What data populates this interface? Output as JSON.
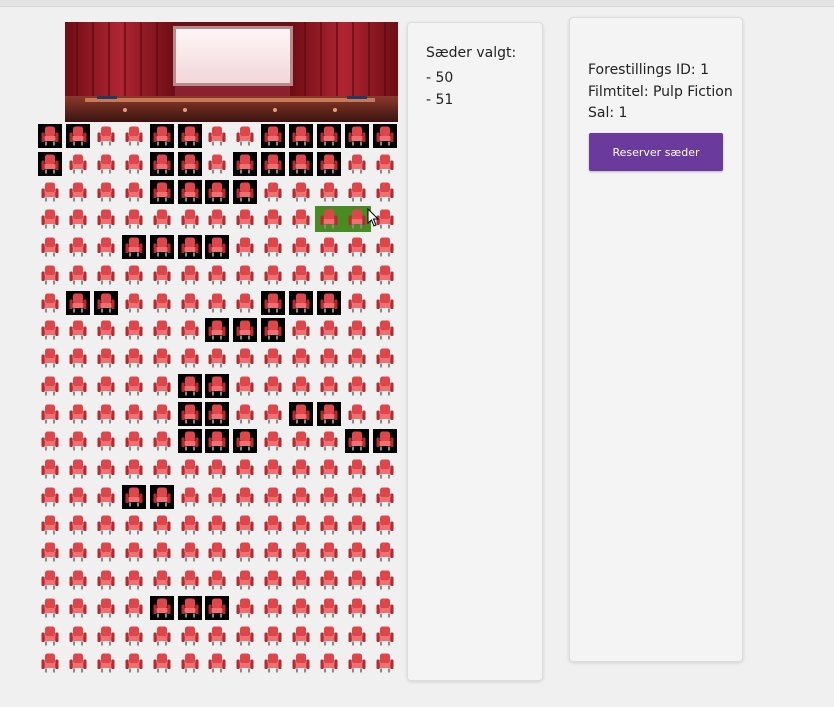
{
  "colors": {
    "accent": "#6a3a9c",
    "seat_red": "#e0454a",
    "reserved_bg": "#000000",
    "selected_bg": "#4a8a22"
  },
  "seating": {
    "rows": 20,
    "cols": 13,
    "reserved": [
      [
        0,
        0
      ],
      [
        0,
        1
      ],
      [
        0,
        4
      ],
      [
        0,
        5
      ],
      [
        0,
        8
      ],
      [
        0,
        9
      ],
      [
        0,
        10
      ],
      [
        0,
        11
      ],
      [
        0,
        12
      ],
      [
        1,
        0
      ],
      [
        1,
        4
      ],
      [
        1,
        5
      ],
      [
        1,
        7
      ],
      [
        1,
        8
      ],
      [
        1,
        9
      ],
      [
        1,
        10
      ],
      [
        2,
        4
      ],
      [
        2,
        5
      ],
      [
        2,
        6
      ],
      [
        2,
        7
      ],
      [
        4,
        3
      ],
      [
        4,
        4
      ],
      [
        4,
        5
      ],
      [
        4,
        6
      ],
      [
        6,
        1
      ],
      [
        6,
        2
      ],
      [
        6,
        8
      ],
      [
        6,
        9
      ],
      [
        6,
        10
      ],
      [
        7,
        6
      ],
      [
        7,
        7
      ],
      [
        7,
        8
      ],
      [
        9,
        5
      ],
      [
        9,
        6
      ],
      [
        10,
        5
      ],
      [
        10,
        6
      ],
      [
        10,
        9
      ],
      [
        10,
        10
      ],
      [
        11,
        5
      ],
      [
        11,
        6
      ],
      [
        11,
        7
      ],
      [
        11,
        11
      ],
      [
        11,
        12
      ],
      [
        13,
        3
      ],
      [
        13,
        4
      ],
      [
        17,
        4
      ],
      [
        17,
        5
      ],
      [
        17,
        6
      ]
    ],
    "selected": [
      [
        3,
        10
      ],
      [
        3,
        11
      ]
    ]
  },
  "selected_panel": {
    "title": "Sæder valgt:",
    "seats": [
      "- 50",
      "- 51"
    ]
  },
  "info_panel": {
    "show_id": "Forestillings ID: 1",
    "movie_title": "Filmtitel: Pulp Fiction",
    "hall": "Sal: 1",
    "reserve_button": "Reserver sæder"
  }
}
